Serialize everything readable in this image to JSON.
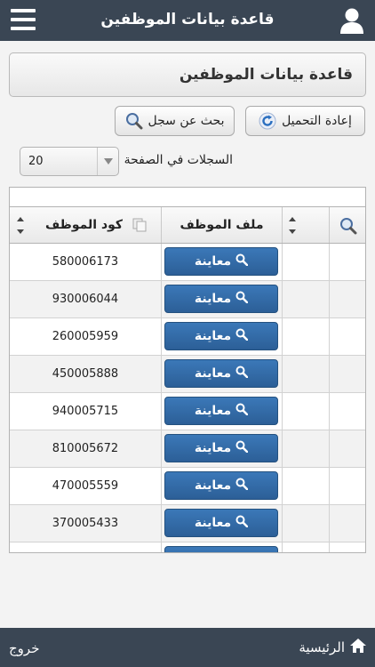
{
  "header": {
    "title": "قاعدة بيانات الموظفين",
    "menu_icon": "hamburger-icon",
    "user_icon": "user-icon"
  },
  "panel": {
    "title": "قاعدة بيانات الموظفين"
  },
  "toolbar": {
    "reload_label": "إعادة التحميل",
    "search_label": "بحث عن سجل"
  },
  "pagination": {
    "per_page_label": "السجلات في الصفحة",
    "per_page_value": "20"
  },
  "table": {
    "columns": {
      "employee_code": "كود الموظف",
      "employee_file": "ملف الموظف"
    },
    "view_label": "معاينة",
    "rows": [
      {
        "code": "580006173"
      },
      {
        "code": "930006044"
      },
      {
        "code": "260005959"
      },
      {
        "code": "450005888"
      },
      {
        "code": "940005715"
      },
      {
        "code": "810005672"
      },
      {
        "code": "470005559"
      },
      {
        "code": "370005433"
      }
    ]
  },
  "footer": {
    "home_label": "الرئيسية",
    "logout_label": "خروج"
  },
  "colors": {
    "header_bg": "#3a4654",
    "view_button": "#2f6aa8",
    "reload_icon": "#2b6fc0"
  }
}
